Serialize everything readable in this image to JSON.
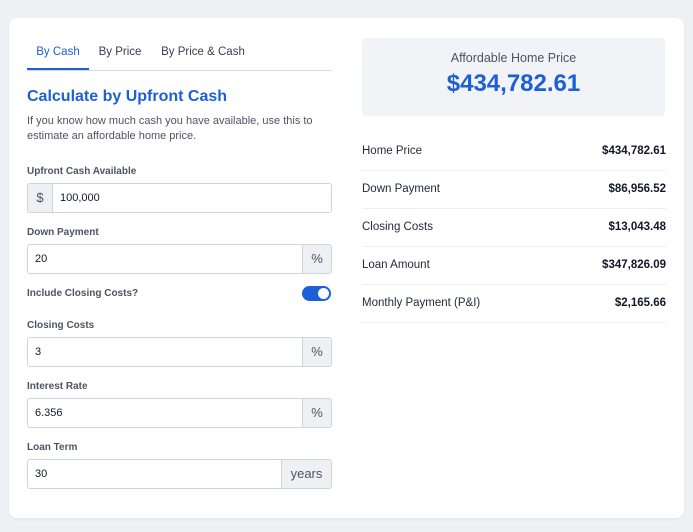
{
  "tabs": [
    {
      "label": "By Cash",
      "active": true
    },
    {
      "label": "By Price",
      "active": false
    },
    {
      "label": "By Price & Cash",
      "active": false
    }
  ],
  "form": {
    "heading": "Calculate by Upfront Cash",
    "description": "If you know how much cash you have available, use this to estimate an affordable home price.",
    "upfront_cash": {
      "label": "Upfront Cash Available",
      "prefix": "$",
      "value": "100,000"
    },
    "down_payment": {
      "label": "Down Payment",
      "value": "20",
      "suffix": "%"
    },
    "include_closing": {
      "label": "Include Closing Costs?",
      "checked": true
    },
    "closing_costs": {
      "label": "Closing Costs",
      "value": "3",
      "suffix": "%"
    },
    "interest_rate": {
      "label": "Interest Rate",
      "value": "6.356",
      "suffix": "%"
    },
    "loan_term": {
      "label": "Loan Term",
      "value": "30",
      "suffix": "years"
    }
  },
  "result": {
    "label": "Affordable Home Price",
    "value": "$434,782.61"
  },
  "summary": [
    {
      "key": "Home Price",
      "value": "$434,782.61"
    },
    {
      "key": "Down Payment",
      "value": "$86,956.52"
    },
    {
      "key": "Closing Costs",
      "value": "$13,043.48"
    },
    {
      "key": "Loan Amount",
      "value": "$347,826.09"
    },
    {
      "key": "Monthly Payment (P&I)",
      "value": "$2,165.66"
    }
  ],
  "colors": {
    "accent": "#1d5fd6",
    "background": "#eef0f4",
    "card": "#ffffff",
    "result_box": "#f1f3f6"
  }
}
